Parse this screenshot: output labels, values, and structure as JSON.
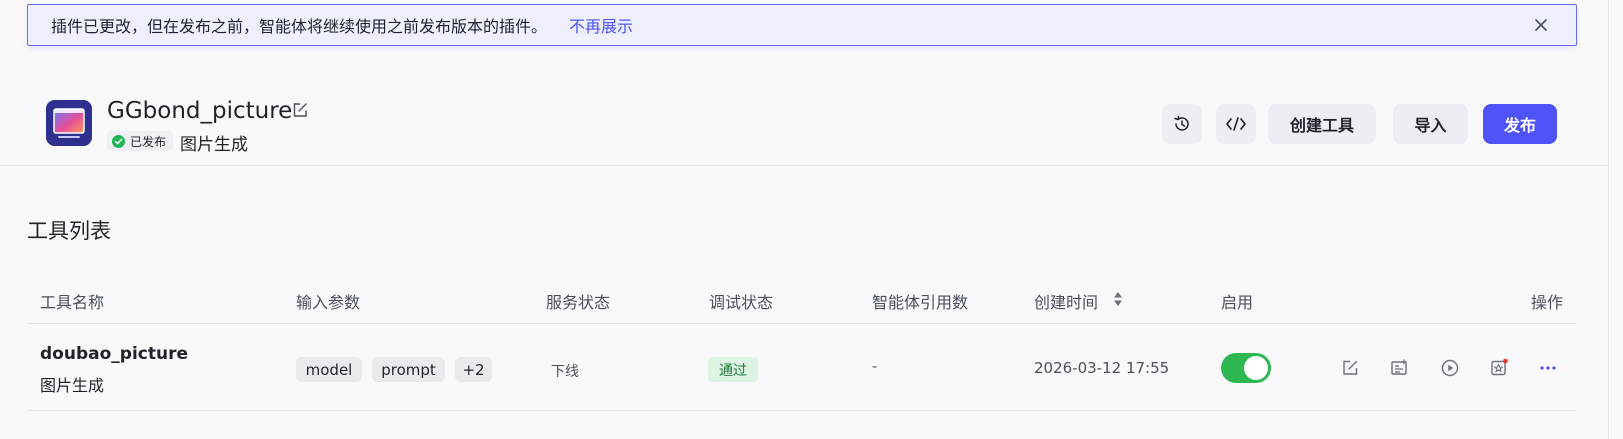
{
  "banner": {
    "message": "插件已更改，但在发布之前，智能体将继续使用之前发布版本的插件。",
    "dismiss_link": "不再展示",
    "close_icon": "close-icon"
  },
  "plugin": {
    "name": "GGbond_picture",
    "status": "已发布",
    "description": "图片生成",
    "icon": "image-icon"
  },
  "toolbar": {
    "history_icon": "history-icon",
    "code_icon": "code-icon",
    "create_tool_label": "创建工具",
    "import_label": "导入",
    "publish_label": "发布"
  },
  "section": {
    "title": "工具列表"
  },
  "table": {
    "columns": [
      "工具名称",
      "输入参数",
      "服务状态",
      "调试状态",
      "智能体引用数",
      "创建时间",
      "启用",
      "操作"
    ],
    "rows": [
      {
        "name": "doubao_picture",
        "description": "图片生成",
        "params": [
          "model",
          "prompt",
          "+2"
        ],
        "service_status": "下线",
        "debug_status": "通过",
        "agent_refs": "-",
        "created_at": "2026-03-12 17:55",
        "enabled": true
      }
    ]
  },
  "colors": {
    "accent": "#4d53f7",
    "success": "#2eb852",
    "banner_bg": "#eef0ff"
  }
}
